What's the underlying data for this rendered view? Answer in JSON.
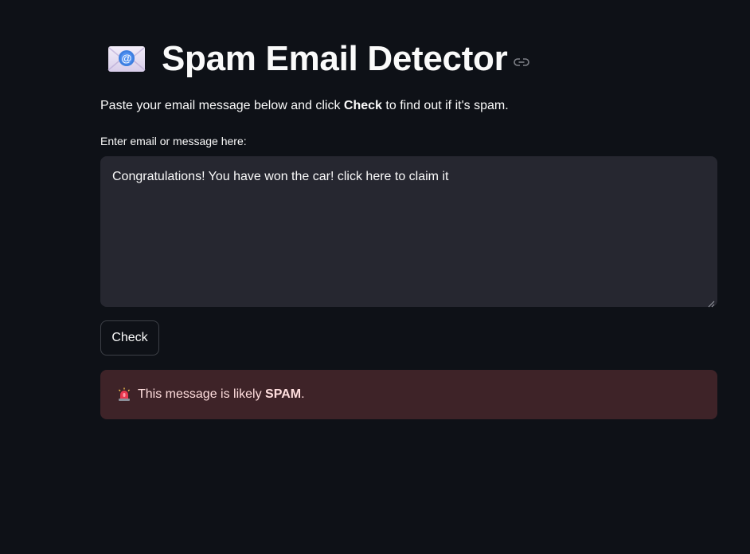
{
  "header": {
    "icon": "envelope-icon",
    "title": "Spam Email Detector",
    "anchor_icon": "link-icon"
  },
  "intro": {
    "before": "Paste your email message below and click ",
    "bold": "Check",
    "after": " to find out if it's spam."
  },
  "input": {
    "label": "Enter email or message here:",
    "value": "Congratulations! You have won the car! click here to claim it"
  },
  "button": {
    "label": "Check"
  },
  "result": {
    "icon": "rotating-light-icon",
    "before": "This message is likely ",
    "bold": "SPAM",
    "after": ".",
    "bg_color": "#3e2328",
    "text_color": "#ffdede"
  },
  "colors": {
    "background": "#0e1117",
    "input_bg": "#262730",
    "text": "#fafafa"
  }
}
